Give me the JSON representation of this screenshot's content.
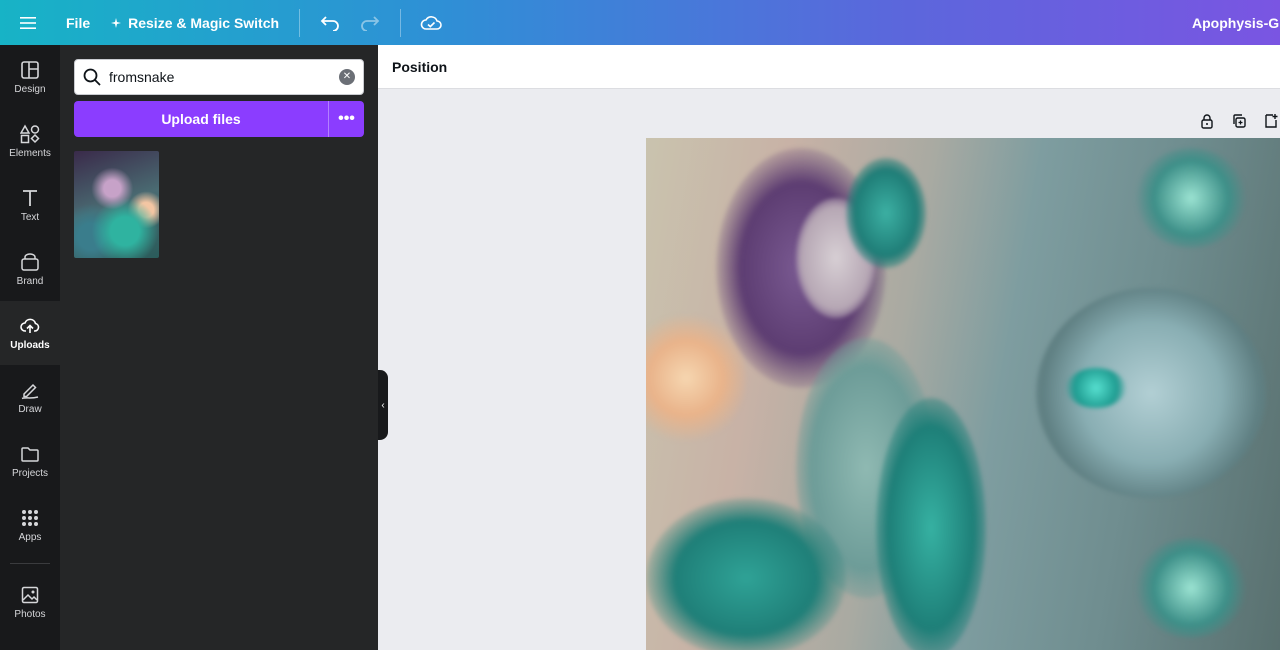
{
  "topbar": {
    "file_label": "File",
    "resize_label": "Resize & Magic Switch",
    "doc_title": "Apophysis-Gut"
  },
  "rail": {
    "items": [
      {
        "label": "Design",
        "icon": "layout-icon"
      },
      {
        "label": "Elements",
        "icon": "shapes-icon"
      },
      {
        "label": "Text",
        "icon": "text-icon"
      },
      {
        "label": "Brand",
        "icon": "brand-icon"
      },
      {
        "label": "Uploads",
        "icon": "cloud-upload-icon",
        "active": true
      },
      {
        "label": "Draw",
        "icon": "pen-icon"
      },
      {
        "label": "Projects",
        "icon": "folder-icon"
      },
      {
        "label": "Apps",
        "icon": "grid-icon"
      },
      {
        "label": "Photos",
        "icon": "image-icon"
      }
    ]
  },
  "panel": {
    "search_value": "fromsnake",
    "upload_label": "Upload files",
    "more_label": "•••"
  },
  "context_toolbar": {
    "position_label": "Position"
  },
  "colors": {
    "brand_purple": "#8b3dff",
    "rail_bg": "#18191b",
    "panel_bg": "#252627"
  }
}
